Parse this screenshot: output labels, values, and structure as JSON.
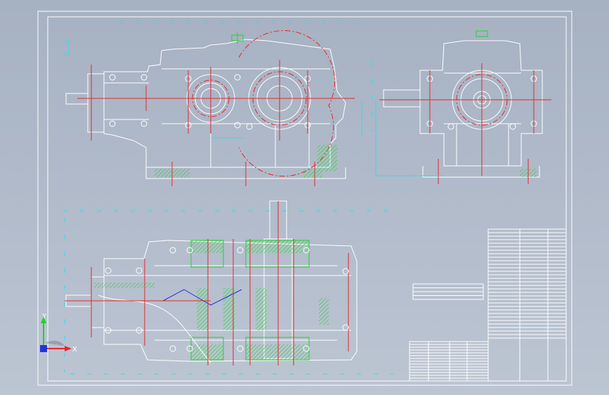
{
  "canvas": {
    "background": "#a9b4c4",
    "line_colors": {
      "outline": "#ffffff",
      "center": "#e8262a",
      "section": "#21d42a",
      "dimension": "#33dcea",
      "hidden": "#2233dd"
    }
  },
  "ucs": {
    "x_label": "X",
    "y_label": "Y",
    "x_color": "#e8262a",
    "y_color": "#21d42a",
    "z_color": "#2233dd"
  },
  "views": [
    "front-view",
    "side-view",
    "top-section-view"
  ],
  "title_block": {
    "rows": 32,
    "small_rows": 14
  }
}
